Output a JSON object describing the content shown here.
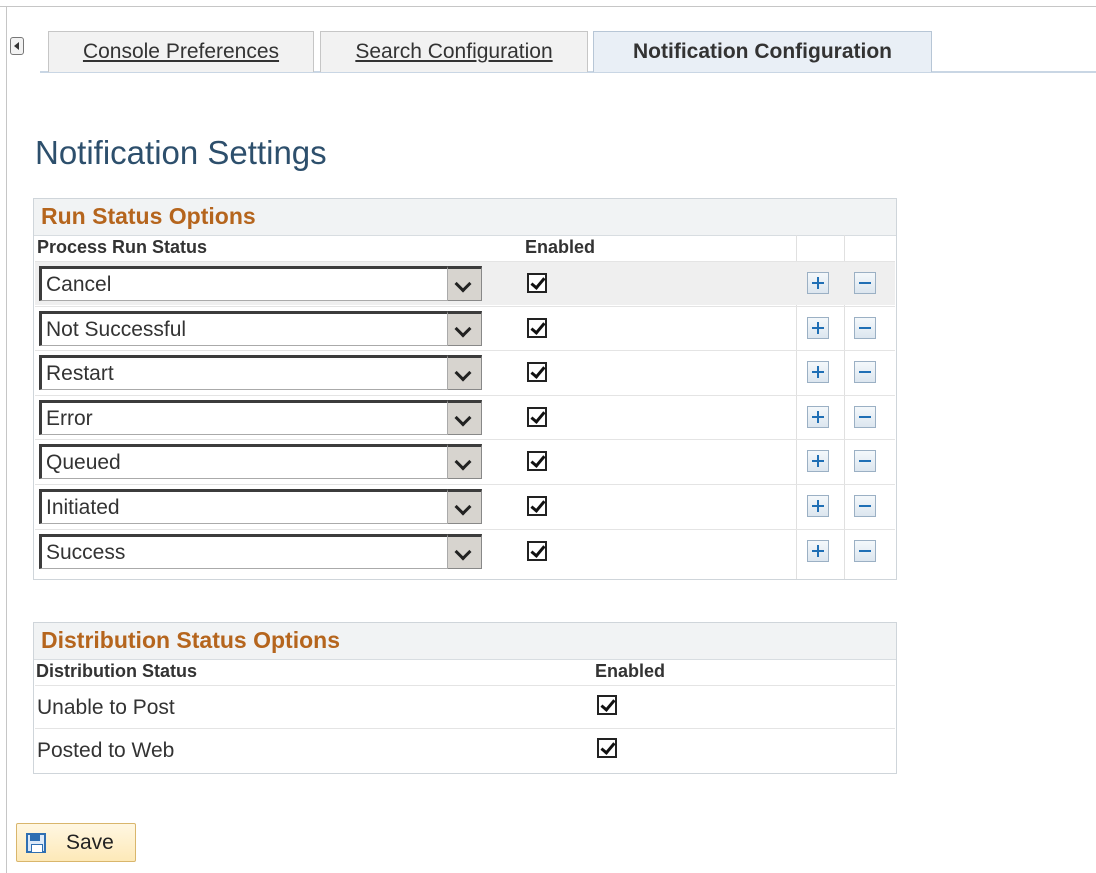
{
  "tabs": [
    {
      "label": "Console Preferences",
      "underline_char": "C",
      "active": false
    },
    {
      "label": "Search Configuration",
      "underline_char": "h",
      "active": false
    },
    {
      "label": "Notification Configuration",
      "active": true
    }
  ],
  "page_title": "Notification Settings",
  "run_status": {
    "title": "Run Status Options",
    "col_process": "Process Run Status",
    "col_enabled": "Enabled",
    "rows": [
      {
        "status": "Cancel",
        "enabled": true
      },
      {
        "status": "Not Successful",
        "enabled": true
      },
      {
        "status": "Restart",
        "enabled": true
      },
      {
        "status": "Error",
        "enabled": true
      },
      {
        "status": "Queued",
        "enabled": true
      },
      {
        "status": "Initiated",
        "enabled": true
      },
      {
        "status": "Success",
        "enabled": true
      }
    ]
  },
  "distribution_status": {
    "title": "Distribution Status Options",
    "col_status": "Distribution Status",
    "col_enabled": "Enabled",
    "rows": [
      {
        "status": "Unable to Post",
        "enabled": true
      },
      {
        "status": "Posted to Web",
        "enabled": true
      }
    ]
  },
  "save_label": "Save",
  "colors": {
    "group_title": "#b5651d",
    "page_title": "#2d4f6c",
    "grid_button": "#1f6fb5"
  }
}
